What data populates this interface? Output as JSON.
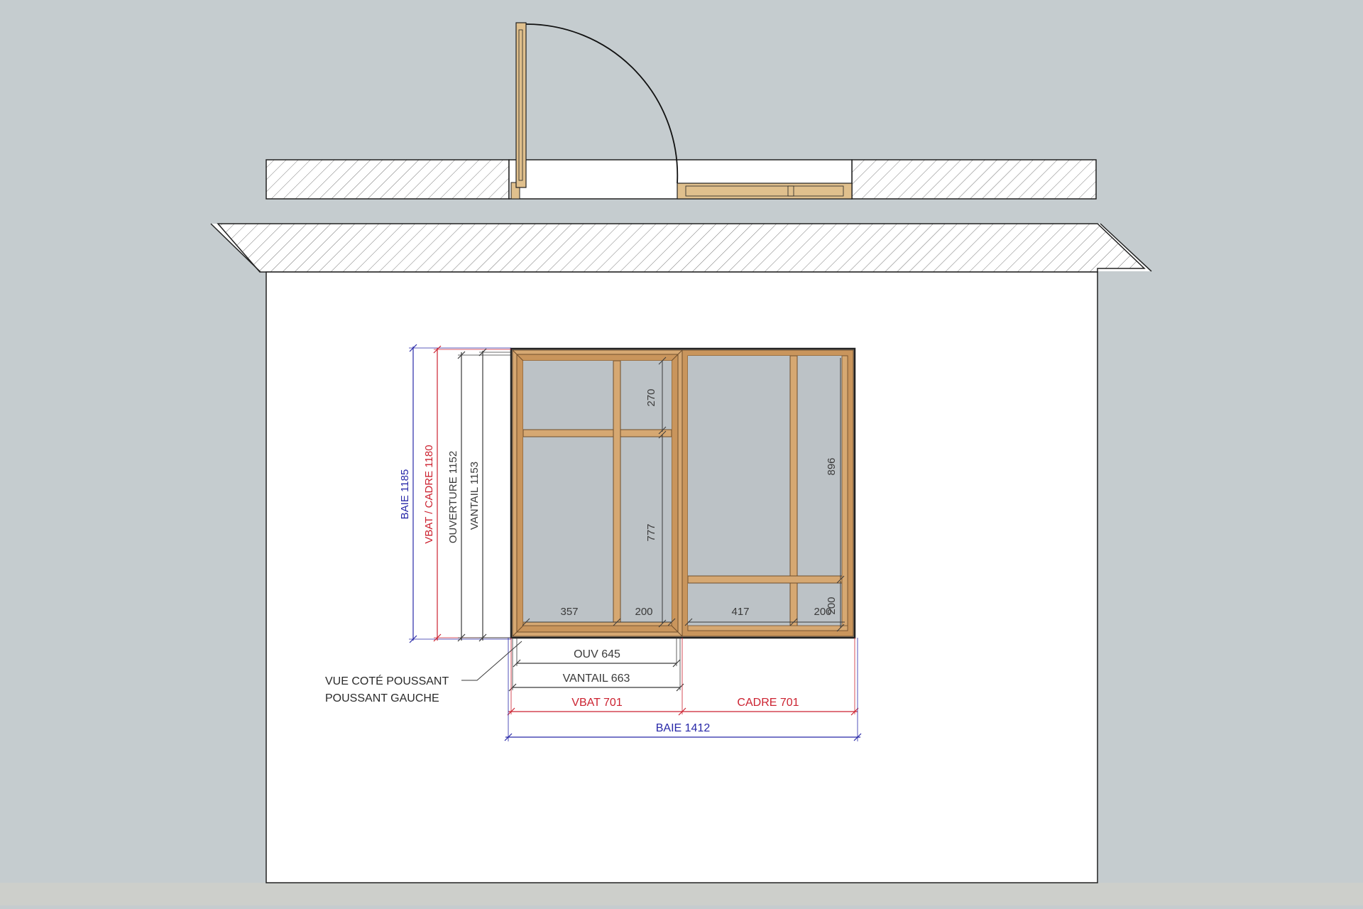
{
  "colors": {
    "background": "#c5cccf",
    "ground": "#cdcfcb",
    "wall": "#ffffff",
    "wood": "#c9955c",
    "wood_light": "#e0c08d",
    "glass": "#bcc2c6",
    "dim_blue": "#2828a8",
    "dim_red": "#cc2230",
    "dim_gray": "#3a3a3a"
  },
  "dimensions": {
    "vertical": {
      "baie": "BAIE 1185",
      "vbat_cadre": "VBAT / CADRE 1180",
      "ouverture": "OUVERTURE 1152",
      "vantail": "VANTAIL 1153"
    },
    "horizontal": {
      "ouv": "OUV 645",
      "vantail": "VANTAIL 663",
      "vbat": "VBAT 701",
      "cadre": "CADRE 701",
      "baie": "BAIE 1412"
    },
    "left_panel": {
      "top_height": "270",
      "bottom_height": "777",
      "left_width": "357",
      "right_width": "200"
    },
    "right_panel": {
      "upper_height": "896",
      "lower_height": "200",
      "left_width": "417",
      "right_width": "200"
    }
  },
  "annotation": {
    "line1": "VUE COTÉ POUSSANT",
    "line2": "POUSSANT GAUCHE"
  }
}
